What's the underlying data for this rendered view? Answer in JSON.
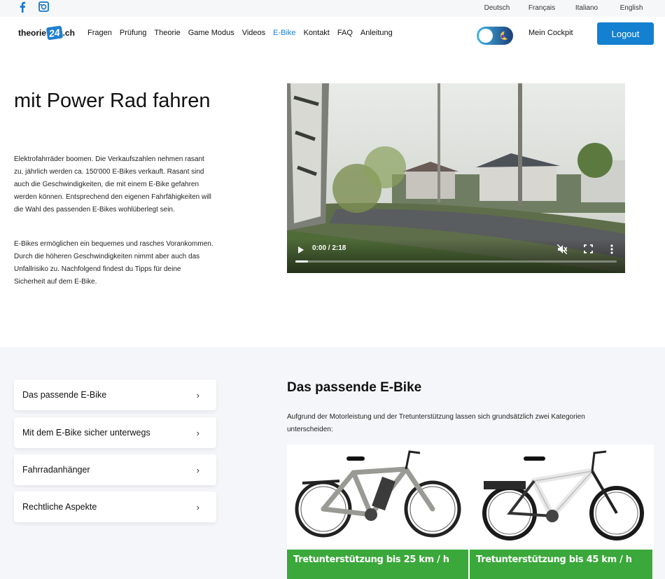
{
  "topbar": {
    "social_icons": [
      "facebook-icon",
      "instagram-icon"
    ],
    "languages": [
      "Deutsch",
      "Français",
      "Italiano",
      "English"
    ]
  },
  "header": {
    "logo": {
      "prefix": "theorie",
      "badge": "24",
      "suffix": ".ch"
    },
    "nav": [
      "Fragen",
      "Prüfung",
      "Theorie",
      "Game Modus",
      "Videos",
      "E-Bike",
      "Kontakt",
      "FAQ",
      "Anleitung"
    ],
    "active_nav": "E-Bike",
    "cockpit_label": "Mein Cockpit",
    "logout_label": "Logout",
    "theme_toggle_icon": "moon-icon"
  },
  "hero": {
    "title": "mit Power Rad fahren",
    "paragraph1": "Elektrofahrräder boomen. Die Verkaufszahlen nehmen rasant zu, jährlich werden ca. 150'000 E-Bikes verkauft. Rasant sind auch die Geschwindigkeiten, die mit einem E-Bike gefahren werden können. Entsprechend den eigenen Fahrfähigkeiten will die Wahl des passenden E-Bikes wohlüberlegt sein.",
    "paragraph2": "E-Bikes ermöglichen ein bequemes und rasches Vorankommen. Durch die höheren Geschwindigkeiten nimmt aber auch das Unfallrisiko zu. Nachfolgend findest du Tipps für deine Sicherheit auf dem E-Bike."
  },
  "video": {
    "time": "0:00 / 2:18",
    "progress_fraction": 0.04,
    "controls": [
      "play-icon",
      "mute-icon",
      "fullscreen-icon",
      "more-options-icon"
    ]
  },
  "sidebar_menu": [
    "Das passende E-Bike",
    "Mit dem E-Bike sicher unterwegs",
    "Fahrradanhänger",
    "Rechtliche Aspekte"
  ],
  "section": {
    "title": "Das passende E-Bike",
    "text": "Aufgrund der Motorleistung und der Tretunterstützung lassen sich grundsätzlich zwei Kategorien unterscheiden:",
    "cards": [
      {
        "label": "Tretunterstützung bis 25 km / h"
      },
      {
        "label": "Tretunterstützung bis 45 km / h"
      }
    ]
  },
  "colors": {
    "accent": "#1480d0",
    "card_label_green": "#3aa83a",
    "lower_bg": "#f5f6f9"
  }
}
